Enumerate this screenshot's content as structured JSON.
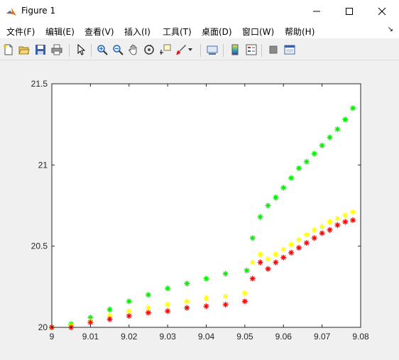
{
  "window": {
    "title": "Figure 1",
    "controls": [
      "minimize",
      "maximize",
      "close"
    ]
  },
  "menu": {
    "items": [
      "文件(F)",
      "编辑(E)",
      "查看(V)",
      "插入(I)",
      "工具(T)",
      "桌面(D)",
      "窗口(W)",
      "帮助(H)"
    ],
    "overflow": "↘"
  },
  "toolbar": {
    "icons": [
      "new-figure-icon",
      "open-file-icon",
      "save-icon",
      "print-icon",
      "edit-plot-arrow-icon",
      "zoom-in-icon",
      "zoom-out-icon",
      "pan-hand-icon",
      "rotate-3d-icon",
      "data-cursor-icon",
      "brush-icon",
      "brush-dropdown-icon",
      "link-plot-icon",
      "colorbar-icon",
      "legend-icon",
      "hide-plot-tools-icon",
      "show-plot-tools-icon"
    ]
  },
  "chart_data": {
    "type": "scatter",
    "marker": "*",
    "xlim": [
      9,
      9.08
    ],
    "ylim": [
      20,
      21.5
    ],
    "xticks": [
      "9",
      "9.01",
      "9.02",
      "9.03",
      "9.04",
      "9.05",
      "9.06",
      "9.07",
      "9.08"
    ],
    "yticks": [
      "20",
      "20.5",
      "21",
      "21.5"
    ],
    "grid": false,
    "colors": {
      "green": "#00ee00",
      "yellow": "#ffff00",
      "red": "#ff0000",
      "darkred": "#aa0000"
    },
    "series": [
      {
        "color": "green",
        "x": [
          9.0,
          9.005,
          9.01,
          9.015,
          9.02,
          9.025,
          9.03,
          9.035,
          9.04,
          9.045,
          9.0505,
          9.052,
          9.054,
          9.056,
          9.058,
          9.06,
          9.062,
          9.064,
          9.066,
          9.068,
          9.07,
          9.072,
          9.074,
          9.076,
          9.078
        ],
        "y": [
          20.0,
          20.02,
          20.06,
          20.11,
          20.16,
          20.2,
          20.24,
          20.27,
          20.3,
          20.33,
          20.35,
          20.55,
          20.68,
          20.75,
          20.8,
          20.86,
          20.92,
          20.98,
          21.02,
          21.07,
          21.12,
          21.17,
          21.22,
          21.28,
          21.35
        ]
      },
      {
        "color": "yellow",
        "x": [
          9.0,
          9.005,
          9.01,
          9.015,
          9.02,
          9.025,
          9.03,
          9.035,
          9.04,
          9.045,
          9.05,
          9.052,
          9.054,
          9.056,
          9.058,
          9.06,
          9.062,
          9.064,
          9.066,
          9.068,
          9.07,
          9.072,
          9.074,
          9.076,
          9.078
        ],
        "y": [
          20.0,
          20.01,
          20.04,
          20.07,
          20.1,
          20.12,
          20.14,
          20.16,
          20.18,
          20.19,
          20.21,
          20.4,
          20.45,
          20.42,
          20.45,
          20.48,
          20.51,
          20.54,
          20.57,
          20.6,
          20.62,
          20.65,
          20.67,
          20.69,
          20.71
        ]
      },
      {
        "color": "red",
        "x": [
          9.0,
          9.005,
          9.01,
          9.015,
          9.02,
          9.025,
          9.03,
          9.035,
          9.04,
          9.045,
          9.05,
          9.052,
          9.054,
          9.056,
          9.058,
          9.06,
          9.062,
          9.064,
          9.066,
          9.068,
          9.07,
          9.072,
          9.074,
          9.076,
          9.078
        ],
        "y": [
          20.0,
          20.0,
          20.03,
          20.05,
          20.07,
          20.09,
          20.1,
          20.12,
          20.13,
          20.14,
          20.16,
          20.3,
          20.4,
          20.36,
          20.4,
          20.43,
          20.46,
          20.49,
          20.52,
          20.55,
          20.58,
          20.6,
          20.63,
          20.65,
          20.66
        ]
      }
    ]
  }
}
